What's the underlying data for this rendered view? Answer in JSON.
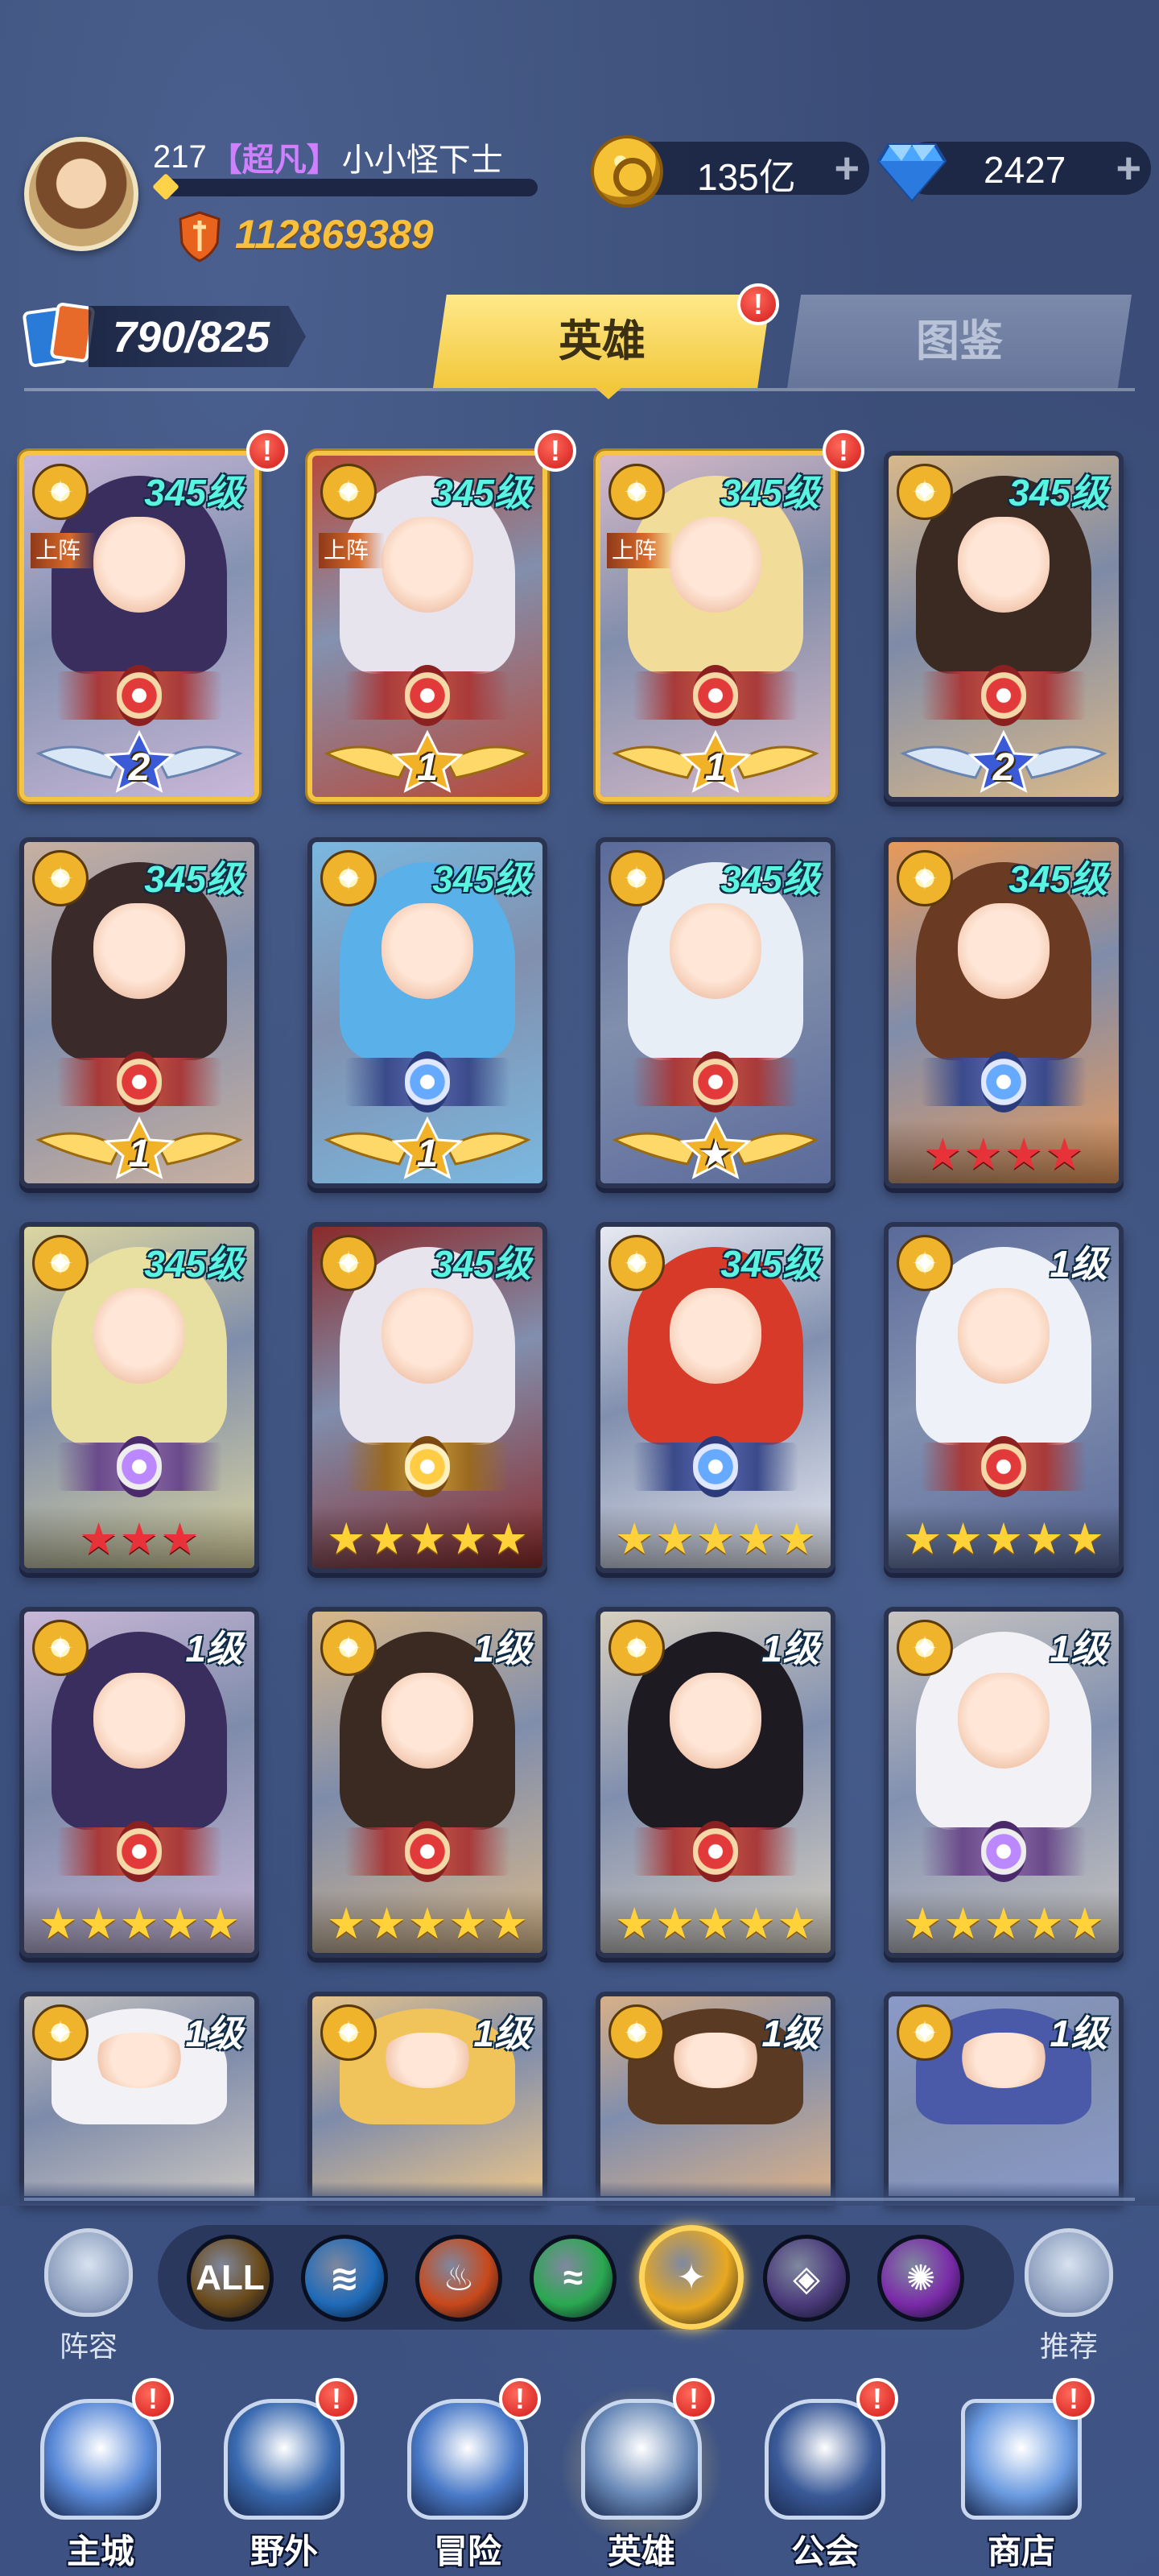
{
  "player": {
    "level": "217",
    "vip_tag": "【超凡】",
    "name": "小小怪下士",
    "power": "112869389"
  },
  "resources": {
    "coins": "135亿",
    "gems": "2427",
    "plus": "+"
  },
  "hero_count": "790/825",
  "tabs": {
    "heroes": "英雄",
    "gallery": "图鉴"
  },
  "badge": "!",
  "on_team_label": "上阵",
  "cards": [
    {
      "level": "345级",
      "team": true,
      "badge": true,
      "tier": "2",
      "wing": "silver",
      "emblem": "red",
      "hair": "#3a2e5e",
      "bg": "#c9b7d8"
    },
    {
      "level": "345级",
      "team": true,
      "badge": true,
      "tier": "1",
      "wing": "gold",
      "emblem": "red",
      "hair": "#e8e4ee",
      "bg": "#b84a3a"
    },
    {
      "level": "345级",
      "team": true,
      "badge": true,
      "tier": "1",
      "wing": "gold",
      "emblem": "red",
      "hair": "#f2dc9a",
      "bg": "#d6b9c8"
    },
    {
      "level": "345级",
      "team": false,
      "badge": false,
      "tier": "2",
      "wing": "silver",
      "emblem": "red",
      "hair": "#3a2a22",
      "bg": "#d8b88a"
    },
    {
      "level": "345级",
      "team": false,
      "badge": false,
      "tier": "1",
      "wing": "gold",
      "emblem": "red",
      "hair": "#3a2a2a",
      "bg": "#c8b0a0"
    },
    {
      "level": "345级",
      "team": false,
      "badge": false,
      "tier": "1",
      "wing": "gold",
      "emblem": "blue",
      "hair": "#5ab0e8",
      "bg": "#7ab8e0"
    },
    {
      "level": "345级",
      "team": false,
      "badge": false,
      "tier": "★",
      "wing": "gold",
      "emblem": "red",
      "hair": "#e8eef6",
      "bg": "#5a6a9a"
    },
    {
      "level": "345级",
      "team": false,
      "badge": false,
      "stars": 4,
      "starColor": "red",
      "emblem": "blue",
      "hair": "#6a3a22",
      "bg": "#e89a5a"
    },
    {
      "level": "345级",
      "team": false,
      "badge": false,
      "stars": 3,
      "starColor": "red",
      "emblem": "purple",
      "hair": "#e8e0a0",
      "bg": "#dcd6a0"
    },
    {
      "level": "345级",
      "team": false,
      "badge": false,
      "stars": 5,
      "starColor": "gold",
      "emblem": "gold",
      "hair": "#e8e4ee",
      "bg": "#8a2a2a"
    },
    {
      "level": "345级",
      "team": false,
      "badge": false,
      "stars": 5,
      "starColor": "gold",
      "emblem": "blue",
      "hair": "#d83a2a",
      "bg": "#e8eaf2"
    },
    {
      "level": "1级",
      "team": false,
      "badge": false,
      "stars": 5,
      "starColor": "gold",
      "emblem": "red",
      "hair": "#eef2f8",
      "bg": "#5a6a9a"
    },
    {
      "level": "1级",
      "team": false,
      "badge": false,
      "stars": 5,
      "starColor": "gold",
      "emblem": "red",
      "hair": "#3a2e5e",
      "bg": "#c9b7d8"
    },
    {
      "level": "1级",
      "team": false,
      "badge": false,
      "stars": 5,
      "starColor": "gold",
      "emblem": "red",
      "hair": "#3a2a22",
      "bg": "#d8b88a"
    },
    {
      "level": "1级",
      "team": false,
      "badge": false,
      "stars": 5,
      "starColor": "gold",
      "emblem": "red",
      "hair": "#1e1a22",
      "bg": "#d8d0c0"
    },
    {
      "level": "1级",
      "team": false,
      "badge": false,
      "stars": 5,
      "starColor": "gold",
      "emblem": "purple",
      "hair": "#f2f2f6",
      "bg": "#c8c4c0"
    },
    {
      "level": "1级",
      "team": false,
      "badge": false,
      "stars": 0,
      "emblem": "none",
      "hair": "#f2f2f6",
      "bg": "#c8c4c0"
    },
    {
      "level": "1级",
      "team": false,
      "badge": false,
      "stars": 0,
      "emblem": "none",
      "hair": "#f0c45a",
      "bg": "#e8c48a"
    },
    {
      "level": "1级",
      "team": false,
      "badge": false,
      "stars": 0,
      "emblem": "none",
      "hair": "#5a3a22",
      "bg": "#d8b088"
    },
    {
      "level": "1级",
      "team": false,
      "badge": false,
      "stars": 0,
      "emblem": "none",
      "hair": "#4a5aa8",
      "bg": "#8a9ac8"
    }
  ],
  "filters": {
    "lineup_label": "阵容",
    "recommend_label": "推荐",
    "items": [
      {
        "id": "all",
        "label": "ALL",
        "color": "#6a4a1a"
      },
      {
        "id": "water",
        "label": "",
        "color": "#1e6ab8"
      },
      {
        "id": "fire",
        "label": "",
        "color": "#c8481a"
      },
      {
        "id": "wind",
        "label": "",
        "color": "#2aa850"
      },
      {
        "id": "light",
        "label": "",
        "color": "#e8a820",
        "selected": true
      },
      {
        "id": "dark",
        "label": "",
        "color": "#4a3a7a"
      },
      {
        "id": "arcane",
        "label": "",
        "color": "#7a2aa8"
      }
    ]
  },
  "nav": [
    {
      "label": "主城",
      "badge": true
    },
    {
      "label": "野外",
      "badge": true
    },
    {
      "label": "冒险",
      "badge": true
    },
    {
      "label": "英雄",
      "badge": true,
      "active": true
    },
    {
      "label": "公会",
      "badge": true
    },
    {
      "label": "商店",
      "badge": true
    }
  ]
}
